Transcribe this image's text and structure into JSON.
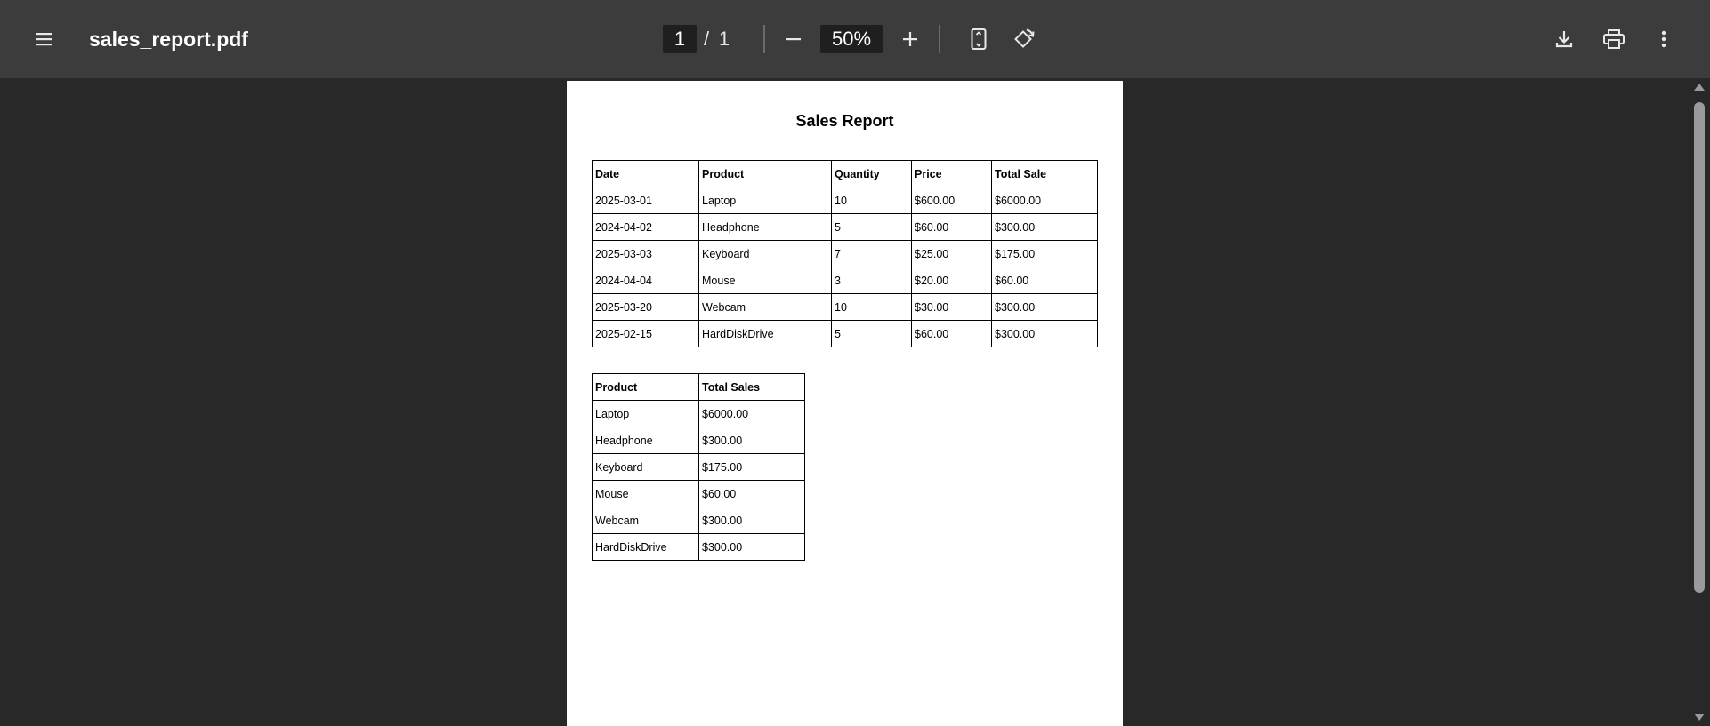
{
  "toolbar": {
    "file_name": "sales_report.pdf",
    "current_page": "1",
    "page_separator": "/",
    "total_pages": "1",
    "zoom_level": "50%"
  },
  "icons": {
    "menu": "menu-icon",
    "zoom_out": "minus-icon",
    "zoom_in": "plus-icon",
    "fit_page": "fit-to-page-icon",
    "rotate": "rotate-icon",
    "download": "download-icon",
    "print": "print-icon",
    "more": "more-vertical-icon"
  },
  "colors": {
    "toolbar_bg": "#3c3c3c",
    "viewer_bg": "#282828",
    "page_bg": "#ffffff"
  },
  "document": {
    "title": "Sales Report",
    "sales_table": {
      "headers": [
        "Date",
        "Product",
        "Quantity",
        "Price",
        "Total Sale"
      ],
      "rows": [
        [
          "2025-03-01",
          "Laptop",
          "10",
          "$600.00",
          "$6000.00"
        ],
        [
          "2024-04-02",
          "Headphone",
          "5",
          "$60.00",
          "$300.00"
        ],
        [
          "2025-03-03",
          "Keyboard",
          "7",
          "$25.00",
          "$175.00"
        ],
        [
          "2024-04-04",
          "Mouse",
          "3",
          "$20.00",
          "$60.00"
        ],
        [
          "2025-03-20",
          "Webcam",
          "10",
          "$30.00",
          "$300.00"
        ],
        [
          "2025-02-15",
          "HardDiskDrive",
          "5",
          "$60.00",
          "$300.00"
        ]
      ]
    },
    "summary_table": {
      "headers": [
        "Product",
        "Total Sales"
      ],
      "rows": [
        [
          "Laptop",
          "$6000.00"
        ],
        [
          "Headphone",
          "$300.00"
        ],
        [
          "Keyboard",
          "$175.00"
        ],
        [
          "Mouse",
          "$60.00"
        ],
        [
          "Webcam",
          "$300.00"
        ],
        [
          "HardDiskDrive",
          "$300.00"
        ]
      ]
    }
  }
}
